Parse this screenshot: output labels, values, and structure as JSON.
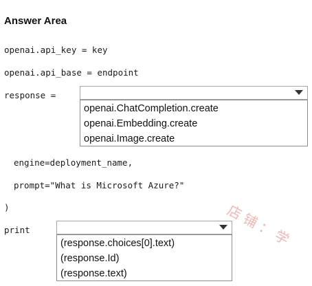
{
  "answer_area": {
    "title": "Answer Area"
  },
  "code_lines": {
    "api_key": "openai.api_key = key",
    "api_base": "openai.api_base = endpoint",
    "response_prefix": "response =",
    "engine": "engine=deployment_name,",
    "prompt": "prompt=\"What is Microsoft Azure?\"",
    "close_paren": ")",
    "print_prefix": "print"
  },
  "dropdown_response": {
    "selected": "",
    "options": [
      "openai.ChatCompletion.create",
      "openai.Embedding.create",
      "openai.Image.create"
    ]
  },
  "dropdown_print": {
    "selected": "",
    "options": [
      "(response.choices[0].text)",
      "(response.Id)",
      "(response.text)"
    ]
  },
  "watermark": {
    "text": "店铺：学"
  }
}
